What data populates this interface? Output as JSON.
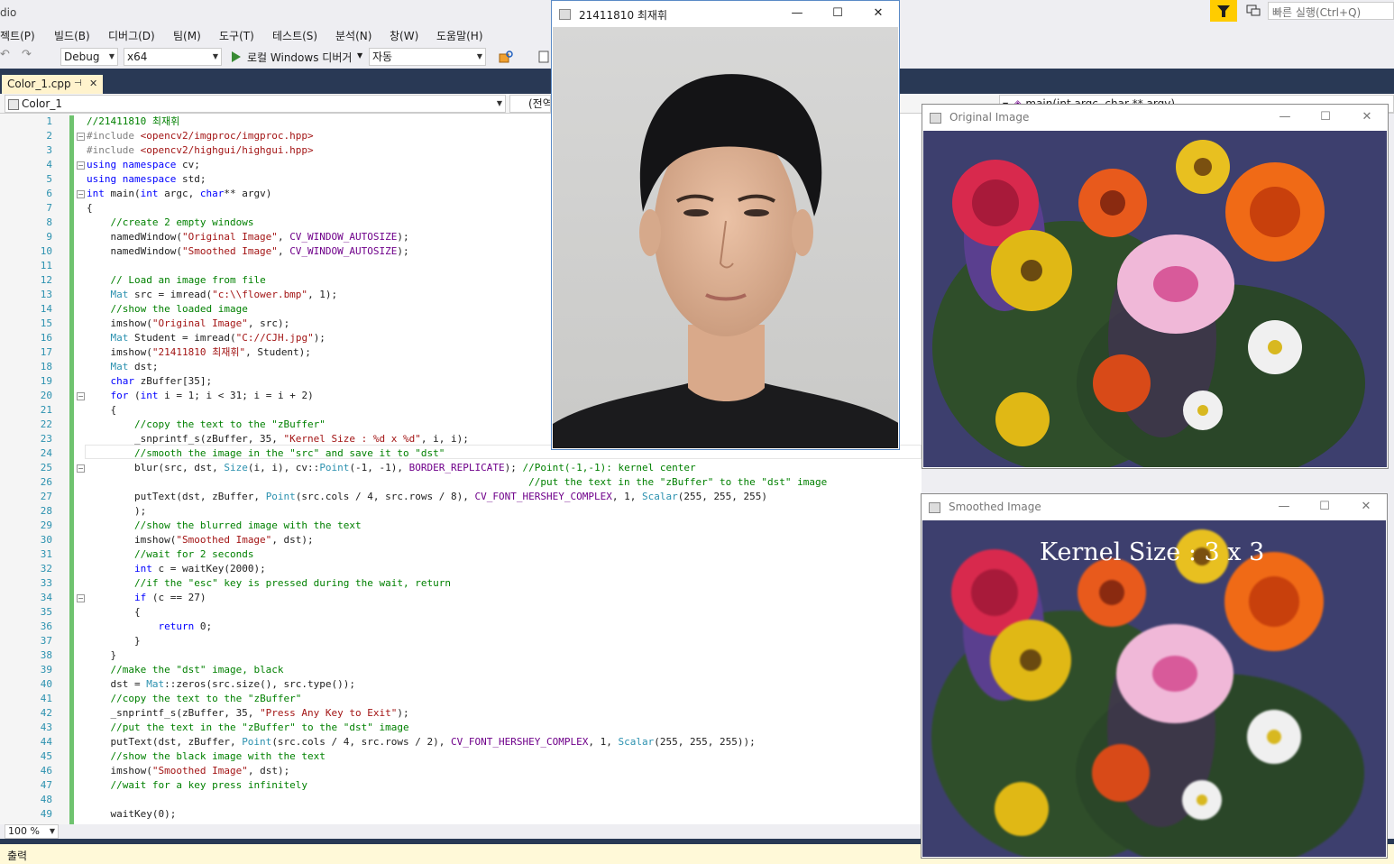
{
  "app": {
    "title_fragment": "dio"
  },
  "menu": {
    "items": [
      "젝트(P)",
      "빌드(B)",
      "디버그(D)",
      "팀(M)",
      "도구(T)",
      "테스트(S)",
      "분석(N)",
      "창(W)",
      "도움말(H)"
    ]
  },
  "quick_launch": {
    "placeholder": "빠른 실행(Ctrl+Q)"
  },
  "toolbar": {
    "config": "Debug",
    "platform": "x64",
    "debugger_label": "로컬 Windows 디버거",
    "mode": "자동"
  },
  "tab": {
    "filename": "Color_1.cpp"
  },
  "nav": {
    "project": "Color_1",
    "scope": "(전역",
    "member": "main(int argc, char ** argv)"
  },
  "zoom": "100 %",
  "output_label": "출력",
  "code_lines": [
    "//21411810 최재휘",
    "#include <opencv2/imgproc/imgproc.hpp>",
    "#include <opencv2/highgui/highgui.hpp>",
    "using namespace cv;",
    "using namespace std;",
    "int main(int argc, char** argv)",
    "{",
    "    //create 2 empty windows",
    "    namedWindow(\"Original Image\", CV_WINDOW_AUTOSIZE);",
    "    namedWindow(\"Smoothed Image\", CV_WINDOW_AUTOSIZE);",
    "",
    "    // Load an image from file",
    "    Mat src = imread(\"c:\\\\flower.bmp\", 1);",
    "    //show the loaded image",
    "    imshow(\"Original Image\", src);",
    "    Mat Student = imread(\"C://CJH.jpg\");",
    "    imshow(\"21411810 최재휘\", Student);",
    "    Mat dst;",
    "    char zBuffer[35];",
    "    for (int i = 1; i < 31; i = i + 2)",
    "    {",
    "        //copy the text to the \"zBuffer\"",
    "        _snprintf_s(zBuffer, 35, \"Kernel Size : %d x %d\", i, i);",
    "        //smooth the image in the \"src\" and save it to \"dst\"",
    "        blur(src, dst, Size(i, i), cv::Point(-1, -1), BORDER_REPLICATE); //Point(-1,-1): kernel center",
    "                                                                          //put the text in the \"zBuffer\" to the \"dst\" image",
    "        putText(dst, zBuffer, Point(src.cols / 4, src.rows / 8), CV_FONT_HERSHEY_COMPLEX, 1, Scalar(255, 255, 255)",
    "        );",
    "        //show the blurred image with the text",
    "        imshow(\"Smoothed Image\", dst);",
    "        //wait for 2 seconds",
    "        int c = waitKey(2000);",
    "        //if the \"esc\" key is pressed during the wait, return",
    "        if (c == 27)",
    "        {",
    "            return 0;",
    "        }",
    "    }",
    "    //make the \"dst\" image, black",
    "    dst = Mat::zeros(src.size(), src.type());",
    "    //copy the text to the \"zBuffer\"",
    "    _snprintf_s(zBuffer, 35, \"Press Any Key to Exit\");",
    "    //put the text in the \"zBuffer\" to the \"dst\" image",
    "    putText(dst, zBuffer, Point(src.cols / 4, src.rows / 2), CV_FONT_HERSHEY_COMPLEX, 1, Scalar(255, 255, 255));",
    "    //show the black image with the text",
    "    imshow(\"Smoothed Image\", dst);",
    "    //wait for a key press infinitely",
    "",
    "    waitKey(0);"
  ],
  "windows": {
    "student": {
      "title": "21411810 최재휘"
    },
    "original": {
      "title": "Original Image"
    },
    "smoothed": {
      "title": "Smoothed Image",
      "overlay_text": "Kernel Size : 3 x 3"
    }
  },
  "icons": [
    "minimize-icon",
    "maximize-icon",
    "close-icon",
    "filter-icon",
    "play-icon",
    "window-icon"
  ],
  "colors": {
    "vs_dark": "#293955",
    "tab_active": "#fff3cd",
    "change_bar": "#6fc36f",
    "line_number": "#2b91af",
    "comment": "#008000",
    "keyword": "#0000ff",
    "string": "#a31515"
  }
}
